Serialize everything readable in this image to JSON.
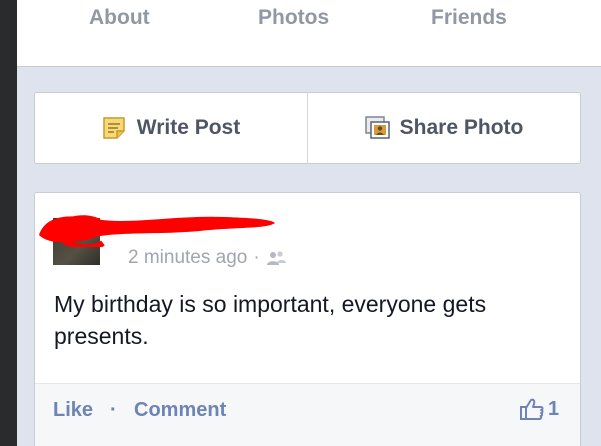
{
  "tabs": {
    "about": "About",
    "photos": "Photos",
    "friends": "Friends"
  },
  "actions": {
    "write_post": "Write Post",
    "share_photo": "Share Photo"
  },
  "post": {
    "timestamp": "2 minutes ago",
    "separator": "·",
    "privacy_icon": "friends-icon",
    "text": "My birthday is so important, everyone gets presents.",
    "like_label": "Like",
    "footer_separator": "·",
    "comment_label": "Comment",
    "like_count": "1"
  },
  "colors": {
    "link": "#6d84b4",
    "tab_text": "#9197a3",
    "background": "#dfe3ee",
    "redaction": "#ff0000"
  }
}
